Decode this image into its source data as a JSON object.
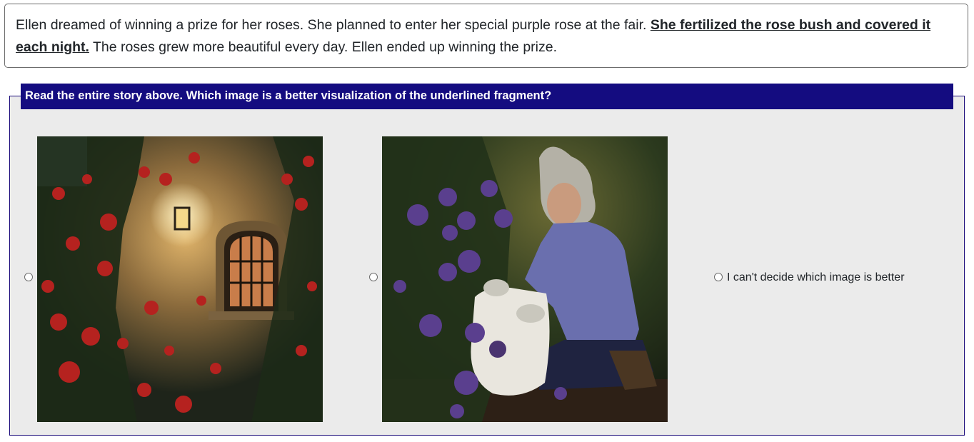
{
  "story": {
    "before": "Ellen dreamed of winning a prize for her roses. She planned to enter her special purple rose at the fair. ",
    "fragment": "She fertilized the rose bush and covered it each night.",
    "after": " The roses grew more beautiful every day. Ellen ended up winning the prize."
  },
  "question": {
    "prompt": "Read the entire story above. Which image is a better visualization of the underlined fragment?"
  },
  "options": {
    "cant_decide_label": "I can't decide which image is better"
  },
  "colors": {
    "question_bar": "#140c80",
    "panel_bg": "#ebebeb",
    "panel_border": "#1a0a7a"
  }
}
